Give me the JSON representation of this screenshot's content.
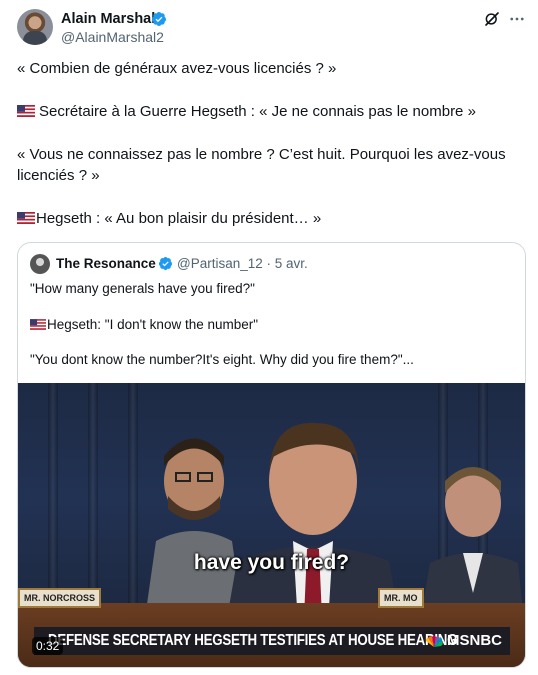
{
  "post": {
    "author_name": "Alain Marshal",
    "author_handle": "@AlainMarshal2",
    "icons": {
      "verified": "verified-badge-icon",
      "grok": "grok-icon",
      "more": "more-options-icon",
      "flag": "us-flag-icon"
    },
    "colors": {
      "verified": "#1d9bf0",
      "text": "#0f1419",
      "secondary": "#536471",
      "border": "#cfd9de"
    },
    "lines": [
      "« Combien de généraux avez-vous licenciés ? »",
      "Secrétaire à la Guerre Hegseth : « Je ne connais pas le nombre »",
      "« Vous ne connaissez pas le nombre ? C’est huit. Pourquoi les avez-vous",
      "licenciés ? »",
      "Hegseth : « Au bon plaisir du président… »"
    ]
  },
  "quote": {
    "author_name": "The Resonance",
    "author_handle": "@Partisan_12 · 5 avr.",
    "lines": [
      "\"How many generals have you fired?\"",
      "Hegseth: \"I don't know the number\"",
      "\"You dont know the number?It's eight. Why did you fire them?\"..."
    ],
    "video": {
      "caption": "have you fired?",
      "nameplate_left": "MR. NORCROSS",
      "nameplate_right": "MR. MO",
      "chyron": "DEFENSE SECRETARY HEGSETH TESTIFIES AT HOUSE HEARING",
      "network": "MSNBC",
      "time": "0:32"
    }
  }
}
